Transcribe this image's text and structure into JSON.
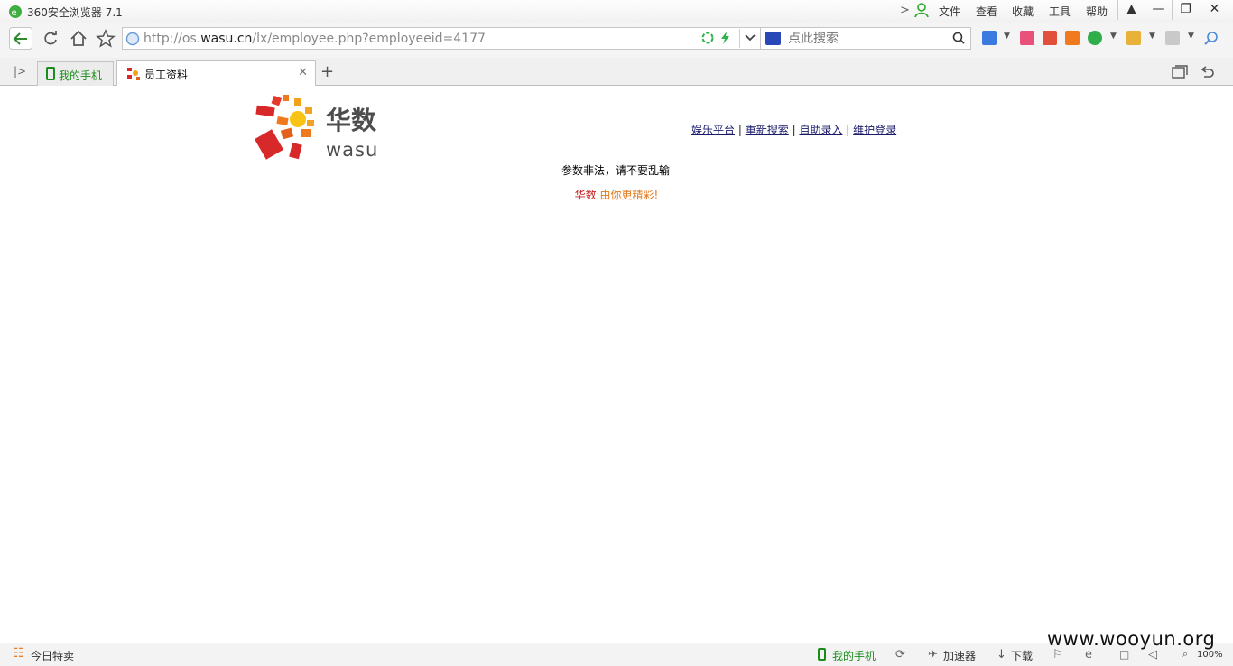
{
  "window": {
    "title": "360安全浏览器 7.1",
    "menu": [
      "文件",
      "查看",
      "收藏",
      "工具",
      "帮助"
    ]
  },
  "navbar": {
    "url_prefix": "http://os.",
    "url_domain": "wasu.cn",
    "url_path": "/lx/employee.php?employeeid=4177",
    "search_placeholder": "点此搜索"
  },
  "tabs": [
    {
      "label": "我的手机",
      "active": false,
      "color": "#1a8c1a"
    },
    {
      "label": "员工资料",
      "active": true
    }
  ],
  "page": {
    "logo_cn": "华数",
    "logo_en": "wasu",
    "nav_links": [
      "娱乐平台",
      "重新搜索",
      "自助录入",
      "维护登录"
    ],
    "separator": "|",
    "error_message": "参数非法，请不要乱输",
    "slogan_brand": "华数",
    "slogan_rest": "由你更精彩!"
  },
  "statusbar": {
    "left": "今日特卖",
    "phone": "我的手机",
    "accelerator": "加速器",
    "download": "下载",
    "zoom": "100%"
  },
  "watermark": "www.wooyun.org"
}
